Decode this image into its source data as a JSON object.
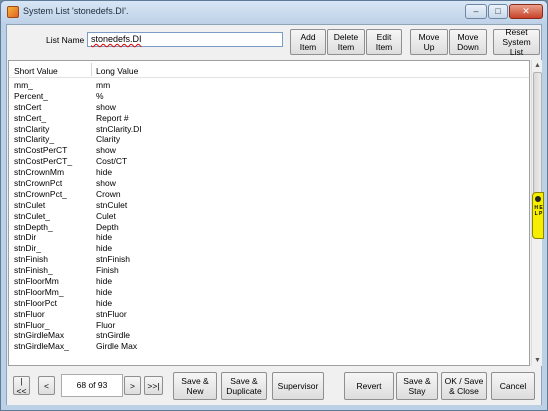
{
  "window": {
    "title": "System List 'stonedefs.DI'.",
    "minimize_glyph": "–",
    "maximize_glyph": "□",
    "close_glyph": "✕"
  },
  "form": {
    "list_name_label": "List Name",
    "list_name_value": "stonedefs.DI"
  },
  "toolbar": {
    "add_item": "Add Item",
    "delete_item": "Delete Item",
    "edit_item": "Edit Item",
    "move_up": "Move Up",
    "move_down": "Move Down",
    "reset_system_list": "Reset System List"
  },
  "table": {
    "columns": [
      "Short Value",
      "Long Value"
    ],
    "rows": [
      [
        "mm_",
        "mm"
      ],
      [
        "Percent_",
        "%"
      ],
      [
        "stnCert",
        "show"
      ],
      [
        "stnCert_",
        "Report #"
      ],
      [
        "stnClarity",
        "stnClarity.DI"
      ],
      [
        "stnClarity_",
        "Clarity"
      ],
      [
        "stnCostPerCT",
        "show"
      ],
      [
        "stnCostPerCT_",
        "Cost/CT"
      ],
      [
        "stnCrownMm",
        "hide"
      ],
      [
        "stnCrownPct",
        "show"
      ],
      [
        "stnCrownPct_",
        "Crown"
      ],
      [
        "stnCulet",
        "stnCulet"
      ],
      [
        "stnCulet_",
        "Culet"
      ],
      [
        "stnDepth_",
        "Depth"
      ],
      [
        "stnDir",
        "hide"
      ],
      [
        "stnDir_",
        "hide"
      ],
      [
        "stnFinish",
        "stnFinish"
      ],
      [
        "stnFinish_",
        "Finish"
      ],
      [
        "stnFloorMm",
        "hide"
      ],
      [
        "stnFloorMm_",
        "hide"
      ],
      [
        "stnFloorPct",
        "hide"
      ],
      [
        "stnFluor",
        "stnFluor"
      ],
      [
        "stnFluor_",
        "Fluor"
      ],
      [
        "stnGirdleMax",
        "stnGirdle"
      ],
      [
        "stnGirdleMax_",
        "Girdle Max"
      ]
    ]
  },
  "scroll": {
    "up_glyph": "▲",
    "down_glyph": "▼"
  },
  "help_tab": {
    "label": "H E L P"
  },
  "pager": {
    "first": "|<<",
    "prev": "<",
    "position": "68 of 93",
    "next": ">",
    "last": ">>|"
  },
  "footer": {
    "save_new": "Save & New",
    "save_duplicate": "Save & Duplicate",
    "supervisor": "Supervisor",
    "revert": "Revert",
    "save_stay": "Save & Stay",
    "ok_save_close": "OK / Save & Close",
    "cancel": "Cancel"
  }
}
